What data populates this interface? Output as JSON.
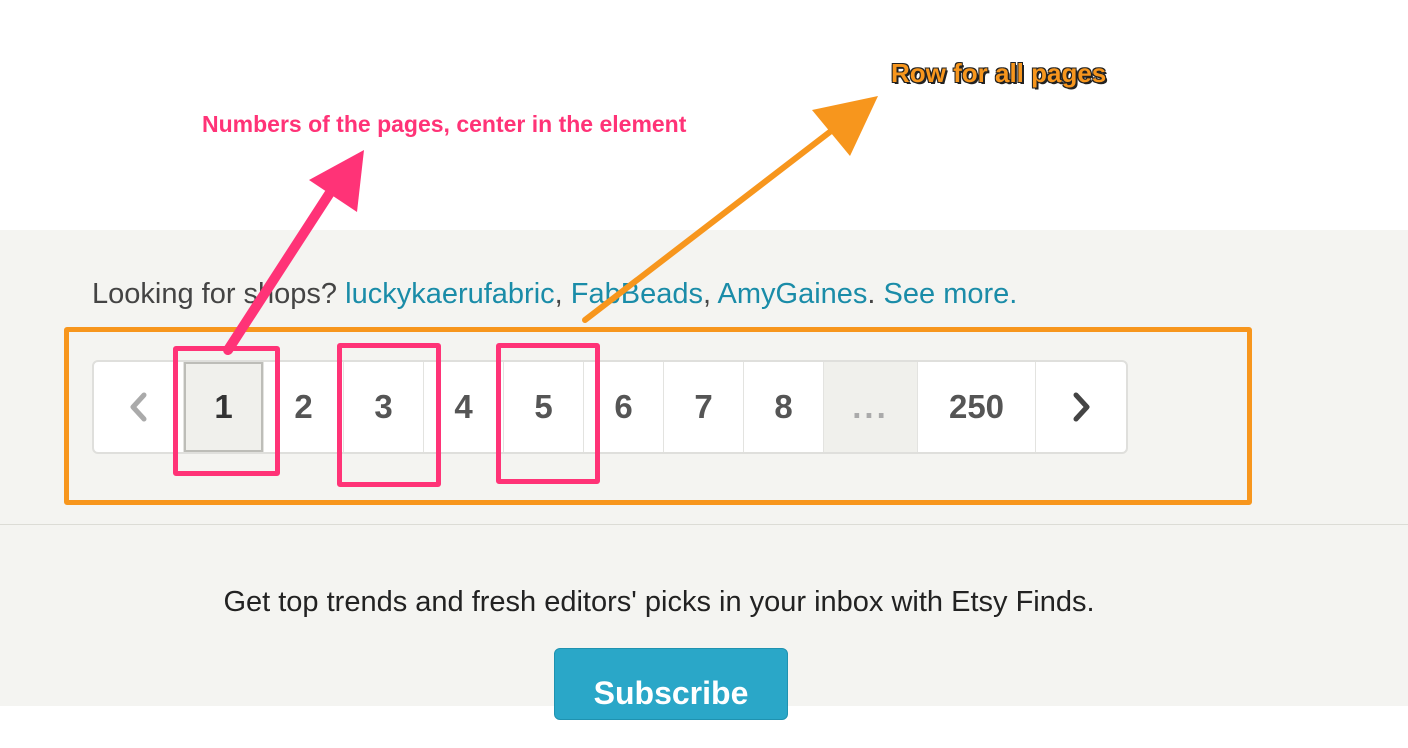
{
  "shops_line": {
    "prefix": "Looking for shops?",
    "shop1": "luckykaerufabric",
    "comma1": ",",
    "shop2": "FabBeads",
    "comma2": ",",
    "shop3": "AmyGaines",
    "period": ".",
    "see_more": "See more."
  },
  "pagination": {
    "prev_icon": "chevron-left-icon",
    "next_icon": "chevron-right-icon",
    "pages": [
      "1",
      "2",
      "3",
      "4",
      "5",
      "6",
      "7",
      "8"
    ],
    "active_page": "1",
    "ellipsis": "...",
    "last_page": "250"
  },
  "newsletter": {
    "text": "Get top trends and fresh editors' picks in your inbox with Etsy Finds.",
    "button_label": "Subscribe"
  },
  "annotations": {
    "pages_note": "Numbers of the pages, center in the element",
    "row_note": "Row for all pages",
    "pink_color": "#ff3377",
    "orange_color": "#f7961d"
  },
  "colors": {
    "link": "#1a8ca8",
    "subscribe_bg": "#2aa7c8",
    "band_bg": "#f4f4f1"
  }
}
